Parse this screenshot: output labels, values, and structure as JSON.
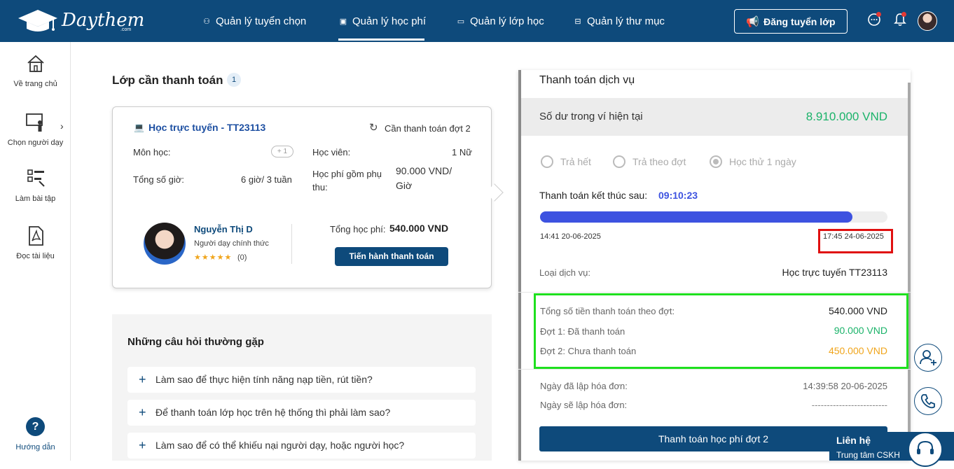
{
  "header": {
    "logo_text": "Daythem",
    "logo_sub": ".com",
    "nav": [
      {
        "label": "Quản lý tuyển chọn"
      },
      {
        "label": "Quản lý học phí"
      },
      {
        "label": "Quản lý lớp học"
      },
      {
        "label": "Quản lý thư mục"
      }
    ],
    "post_button": "Đăng tuyển lớp"
  },
  "sidebar": {
    "items": [
      {
        "label": "Về trang chủ",
        "icon": "home-icon"
      },
      {
        "label": "Chọn người dạy",
        "icon": "teacher-icon"
      },
      {
        "label": "Làm bài tập",
        "icon": "assignment-icon"
      },
      {
        "label": "Đọc tài liệu",
        "icon": "pdf-icon"
      }
    ],
    "help": {
      "label": "Hướng dẫn",
      "symbol": "?"
    }
  },
  "main": {
    "section_title": "Lớp cần thanh toán",
    "count": "1",
    "card": {
      "title": "Học trực tuyến - TT23113",
      "status": "Cần thanh toán đợt 2",
      "subject_label": "Môn học:",
      "subject_more": "+ 1",
      "student_label": "Học viên:",
      "student_value": "1 Nữ",
      "hours_label": "Tổng số giờ:",
      "hours_value": "6 giờ/ 3 tuần",
      "fee_label": "Học phí gồm phụ thu:",
      "fee_value": "90.000 VND/ Giờ",
      "teacher_name": "Nguyễn Thị D",
      "teacher_role": "Người dạy chính thức",
      "rating_stars": "★★★★★",
      "rating_count": "(0)",
      "total_label": "Tổng học phí:",
      "total_value": "540.000 VND",
      "pay_button": "Tiến hành thanh toán"
    },
    "faq": {
      "title": "Những câu hỏi thường gặp",
      "items": [
        "Làm sao để thực hiện tính năng nạp tiền, rút tiền?",
        "Để thanh toán lớp học trên hệ thống thì phải làm sao?",
        "Làm sao để có thể khiếu nại người dạy, hoặc người học?"
      ]
    }
  },
  "payment": {
    "title": "Thanh toán dịch vụ",
    "balance_label": "Số dư trong ví hiện tại",
    "balance_value": "8.910.000 VND",
    "options": [
      "Trả hết",
      "Trả theo đợt",
      "Học thử 1 ngày"
    ],
    "selected_option": "Học thử 1 ngày",
    "countdown_label": "Thanh toán kết thúc sau:",
    "countdown_value": "09:10:23",
    "progress": 0.9,
    "start_time": "14:41 20-06-2025",
    "end_time": "17:45 24-06-2025",
    "service_label": "Loại dịch vụ:",
    "service_value": "Học trực tuyến TT23113",
    "installment_total_label": "Tổng số tiền thanh toán theo đợt:",
    "installment_total_value": "540.000 VND",
    "phase1_label": "Đợt 1: Đã thanh toán",
    "phase1_value": "90.000 VND",
    "phase2_label": "Đợt 2: Chưa thanh toán",
    "phase2_value": "450.000 VND",
    "invoice_created_label": "Ngày đã lập hóa đơn:",
    "invoice_created_value": "14:39:58 20-06-2025",
    "invoice_next_label": "Ngày sẽ lập hóa đơn:",
    "invoice_next_value": "-------------------------",
    "pay_button": "Thanh toán học phí đợt 2"
  },
  "contact": {
    "title": "Liên hệ",
    "subtitle": "Trung tâm CSKH"
  },
  "colors": {
    "primary": "#0e4a7b",
    "link_blue": "#1e50a2",
    "green": "#1bb36a",
    "orange": "#f0a51c",
    "progress": "#3d52e0"
  }
}
